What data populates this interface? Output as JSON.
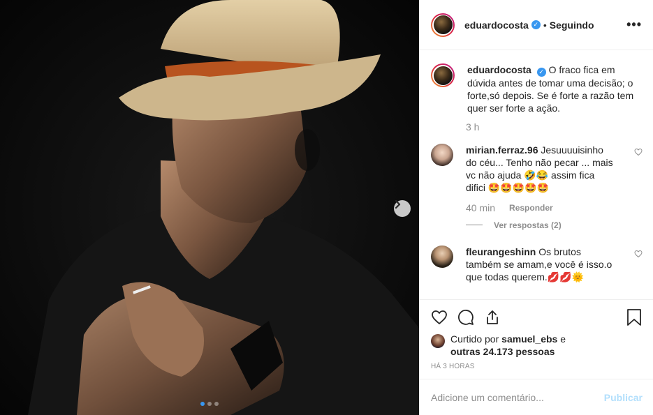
{
  "post": {
    "username": "eduardocosta",
    "follow_status": "Seguindo",
    "separator": "•",
    "more": "•••",
    "verified_mark": "✓"
  },
  "caption": {
    "username": "eduardocosta",
    "text": "O fraco fica em dúvida antes de tomar uma decisão; o forte,só depois. Se é forte a razão tem quer ser forte a ação.",
    "time": "3 h"
  },
  "comments": [
    {
      "username": "mirian.ferraz.96",
      "text": "Jesuuuuisinho do céu... Tenho não pecar ... mais vc não ajuda 🤣😂 assim fica difici 🤩🤩🤩🤩🤩",
      "time": "40 min",
      "reply_label": "Responder",
      "view_replies": "Ver respostas (2)"
    },
    {
      "username": "fleurangeshinn",
      "text": "Os brutos também se amam,e você é isso.o que todas querem.💋💋🌞"
    }
  ],
  "likes": {
    "prefix": "Curtido por",
    "liker": "samuel_ebs",
    "conj": "e",
    "others": "outras 24.173 pessoas"
  },
  "posted_ago": "HÁ 3 HORAS",
  "add_comment": {
    "placeholder": "Adicione um comentário...",
    "publish_label": "Publicar"
  },
  "carousel": {
    "count": 3,
    "active": 1
  },
  "icons": [
    "heart-icon",
    "comment-icon",
    "share-icon",
    "bookmark-icon",
    "chevron-right-icon",
    "more-icon",
    "verified-icon"
  ],
  "colors": {
    "accent": "#3897f0",
    "publish_disabled": "#b2dffc",
    "muted": "#8e8e8e"
  }
}
